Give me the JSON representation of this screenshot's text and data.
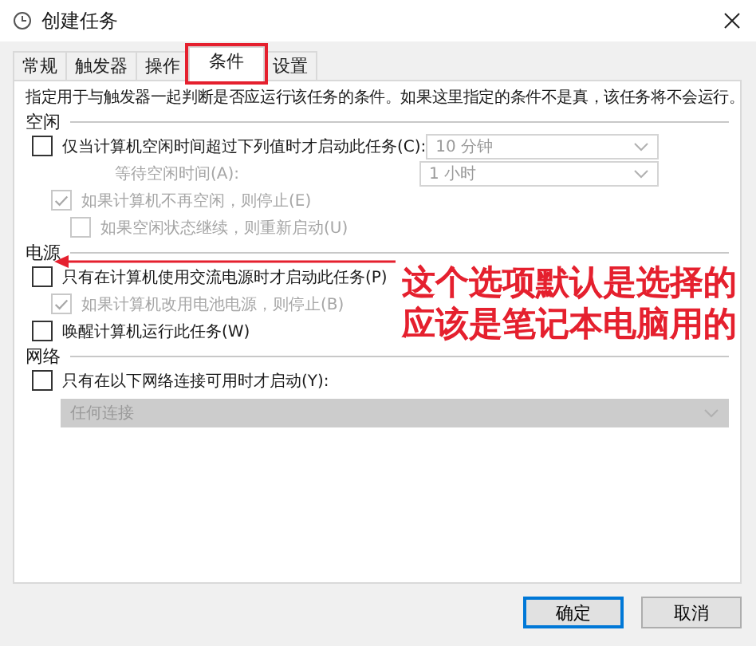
{
  "window": {
    "title": "创建任务"
  },
  "tabs": [
    {
      "label": "常规",
      "selected": false
    },
    {
      "label": "触发器",
      "selected": false
    },
    {
      "label": "操作",
      "selected": false
    },
    {
      "label": "条件",
      "selected": true
    },
    {
      "label": "设置",
      "selected": false
    }
  ],
  "description": "指定用于与触发器一起判断是否应运行该任务的条件。如果这里指定的条件不是真，该任务将不会运行。",
  "sections": [
    {
      "title": "空闲",
      "items": [
        {
          "kind": "checkbox",
          "label": "仅当计算机空闲时间超过下列值时才启动此任务(C):",
          "checked": false,
          "disabled": false,
          "dropdown": "10 分钟",
          "children": [
            {
              "kind": "label",
              "label": "等待空闲时间(A):",
              "disabled": true,
              "dropdown": "1 小时"
            },
            {
              "kind": "checkbox",
              "label": "如果计算机不再空闲，则停止(E)",
              "checked": true,
              "disabled": true,
              "children": [
                {
                  "kind": "checkbox",
                  "label": "如果空闲状态继续，则重新启动(U)",
                  "checked": false,
                  "disabled": true
                }
              ]
            }
          ]
        }
      ]
    },
    {
      "title": "电源",
      "items": [
        {
          "kind": "checkbox",
          "label": "只有在计算机使用交流电源时才启动此任务(P)",
          "checked": false,
          "disabled": false,
          "children": [
            {
              "kind": "checkbox",
              "label": "如果计算机改用电池电源，则停止(B)",
              "checked": true,
              "disabled": true
            }
          ]
        },
        {
          "kind": "checkbox",
          "label": "唤醒计算机运行此任务(W)",
          "checked": false,
          "disabled": false
        }
      ]
    },
    {
      "title": "网络",
      "items": [
        {
          "kind": "checkbox",
          "label": "只有在以下网络连接可用时才启动(Y):",
          "checked": false,
          "disabled": false,
          "children": [
            {
              "kind": "select",
              "value": "任何连接",
              "disabled": true
            }
          ]
        }
      ]
    }
  ],
  "buttons": [
    {
      "label": "确定",
      "default": true
    },
    {
      "label": "取消",
      "default": false
    }
  ],
  "annotation": {
    "lines": [
      "这个选项默认是选择的",
      "应该是笔记本电脑用的"
    ]
  }
}
